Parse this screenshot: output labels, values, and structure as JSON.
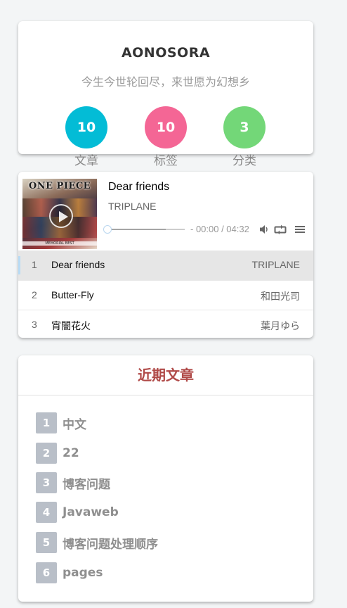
{
  "profile": {
    "site_title": "AONOSORA",
    "subtitle": "今生今世轮回尽，来世愿为幻想乡",
    "stats": [
      {
        "count": "10",
        "label": "文章",
        "color": "#03bcd6"
      },
      {
        "count": "10",
        "label": "标签",
        "color": "#f46695"
      },
      {
        "count": "3",
        "label": "分类",
        "color": "#73d778"
      }
    ]
  },
  "player": {
    "album_logo": "ONE PIECE",
    "album_caption": "MEMORIAL BEST",
    "current_title": "Dear friends",
    "current_artist": "TRIPLANE",
    "time": "- 00:00 / 04:32",
    "loaded_fraction": 0.75,
    "playlist": [
      {
        "num": "1",
        "title": "Dear friends",
        "artist": "TRIPLANE",
        "active": true
      },
      {
        "num": "2",
        "title": "Butter-Fly",
        "artist": "和田光司",
        "active": false
      },
      {
        "num": "3",
        "title": "宵闇花火",
        "artist": "葉月ゆら",
        "active": false
      }
    ],
    "icons": [
      "play-icon",
      "volume-icon",
      "loop-icon",
      "menu-icon"
    ]
  },
  "recent": {
    "heading": "近期文章",
    "posts": [
      {
        "rank": "1",
        "title": "中文"
      },
      {
        "rank": "2",
        "title": "22"
      },
      {
        "rank": "3",
        "title": "博客问题"
      },
      {
        "rank": "4",
        "title": "Javaweb"
      },
      {
        "rank": "5",
        "title": "博客问题处理顺序"
      },
      {
        "rank": "6",
        "title": "pages"
      }
    ]
  }
}
